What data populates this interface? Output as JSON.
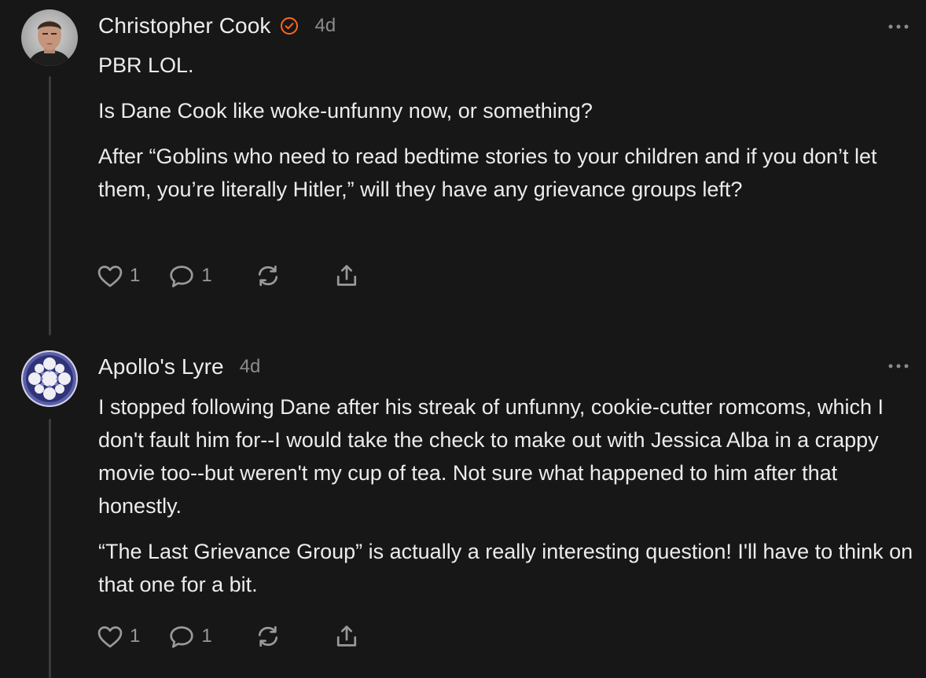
{
  "comments": [
    {
      "author": "Christopher Cook",
      "verified": true,
      "time": "4d",
      "paragraphs": [
        "PBR LOL.",
        "Is Dane Cook like woke-unfunny now, or something?",
        "After “Goblins who need to read bedtime stories to your children and if you don’t let them, you’re literally Hitler,” will they have any grievance groups left?"
      ],
      "likes": "1",
      "replies": "1",
      "icons": [
        "heart-icon",
        "comment-icon",
        "restack-icon",
        "share-icon",
        "more-icon"
      ]
    },
    {
      "author": "Apollo's Lyre",
      "verified": false,
      "time": "4d",
      "paragraphs": [
        "I stopped following Dane after his streak of unfunny, cookie-cutter romcoms, which I don't fault him for--I would take the check to make out with Jessica Alba in a crappy movie too--but weren't my cup of tea. Not sure what happened to him after that honestly.",
        "“The Last Grievance Group” is actually a really interesting question! I'll have to think on that one for a bit."
      ],
      "likes": "1",
      "replies": "1",
      "icons": [
        "heart-icon",
        "comment-icon",
        "restack-icon",
        "share-icon",
        "more-icon"
      ]
    }
  ],
  "colors": {
    "background": "#171717",
    "text": "#ededed",
    "muted": "#8c8c8c",
    "verified_badge": "#ff6719",
    "thread_line": "#3b3b3b"
  }
}
